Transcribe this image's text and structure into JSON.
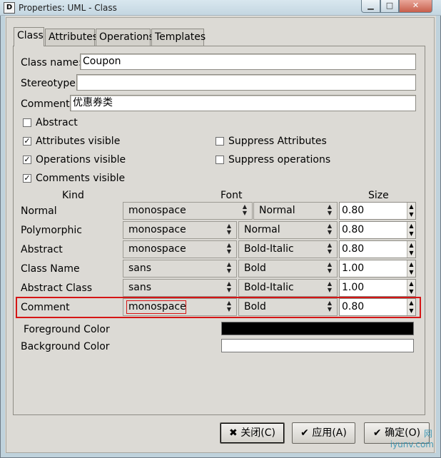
{
  "window": {
    "title": "Properties: UML - Class",
    "icon_glyph": "D",
    "min_glyph": "▁",
    "max_glyph": "□",
    "close_glyph": "✕"
  },
  "tabs": [
    {
      "label": "Class",
      "active": true
    },
    {
      "label": "Attributes",
      "active": false
    },
    {
      "label": "Operations",
      "active": false
    },
    {
      "label": "Templates",
      "active": false
    }
  ],
  "form": {
    "class_name": {
      "label": "Class name:",
      "value": "Coupon"
    },
    "stereotype": {
      "label": "Stereotype:",
      "value": ""
    },
    "comment": {
      "label": "Comment:",
      "value": "优惠券类"
    }
  },
  "checkboxes": [
    {
      "label": "Abstract",
      "checked": false
    },
    {
      "label": "Attributes visible",
      "checked": true
    },
    {
      "label": "Operations visible",
      "checked": true
    },
    {
      "label": "Comments visible",
      "checked": true
    },
    {
      "label": "Suppress Attributes",
      "checked": false
    },
    {
      "label": "Suppress operations",
      "checked": false
    }
  ],
  "check_glyph": "✓",
  "font_table": {
    "headers": {
      "kind": "Kind",
      "font": "Font",
      "size": "Size"
    },
    "rows": [
      {
        "kind": "Normal",
        "font": "monospace",
        "style": "Normal",
        "size": "0.80"
      },
      {
        "kind": "Polymorphic",
        "font": "monospace",
        "style": "Normal",
        "size": "0.80"
      },
      {
        "kind": "Abstract",
        "font": "monospace",
        "style": "Bold-Italic",
        "size": "0.80"
      },
      {
        "kind": "Class Name",
        "font": "sans",
        "style": "Bold",
        "size": "1.00"
      },
      {
        "kind": "Abstract Class",
        "font": "sans",
        "style": "Bold-Italic",
        "size": "1.00"
      },
      {
        "kind": "Comment",
        "font": "monospace",
        "style": "Bold",
        "size": "0.80"
      }
    ],
    "combo_arrow": "▲▼",
    "spin_up": "▲",
    "spin_down": "▼"
  },
  "colors": {
    "foreground_label": "Foreground Color",
    "foreground_value": "#000000",
    "background_label": "Background Color",
    "background_value": "#ffffff",
    "highlight": "#d51515"
  },
  "buttons": {
    "close": "关闭(C)",
    "close_icon": "✖",
    "apply": "应用(A)",
    "apply_icon": "✔",
    "ok": "确定(O)",
    "ok_icon": "✔"
  },
  "watermark": {
    "line1": "网",
    "line2": "iyunv.com"
  }
}
